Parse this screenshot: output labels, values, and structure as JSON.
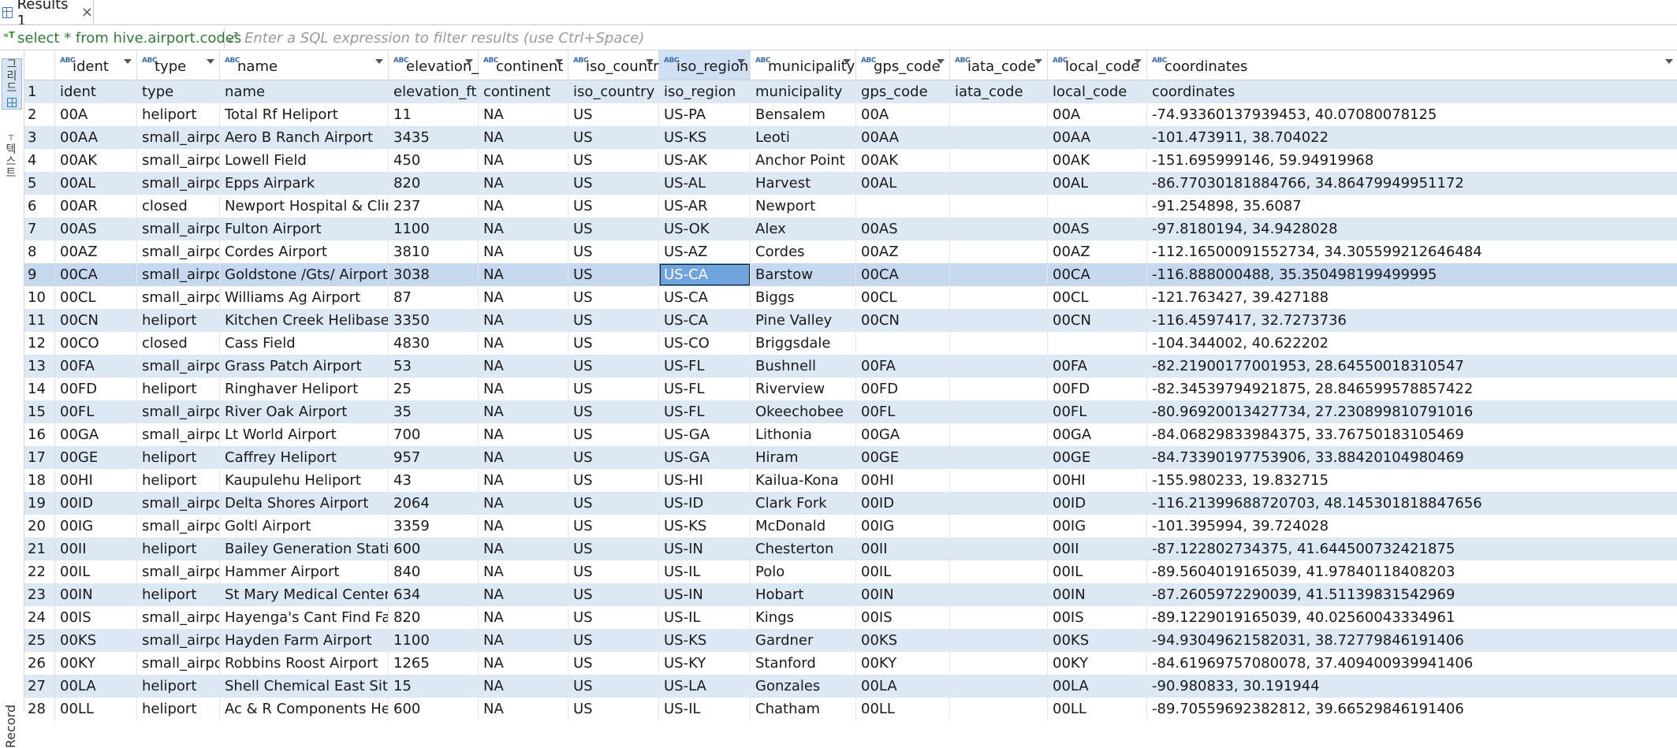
{
  "tab": {
    "title": "Results 1",
    "close": "×"
  },
  "filter": {
    "query": "select * from hive.airport.codes",
    "placeholder": "Enter a SQL expression to filter results (use Ctrl+Space)"
  },
  "sidebar": {
    "grid_label": "그리드",
    "text_label": "텍스트",
    "record_label": "Record"
  },
  "type_badge": "ABC",
  "columns": [
    "ident",
    "type",
    "name",
    "elevation_ft",
    "continent",
    "iso_country",
    "iso_region",
    "municipality",
    "gps_code",
    "iata_code",
    "local_code",
    "coordinates"
  ],
  "selected_column": "iso_region",
  "rows": [
    {
      "n": "1",
      "cells": [
        "ident",
        "type",
        "name",
        "elevation_ft",
        "continent",
        "iso_country",
        "iso_region",
        "municipality",
        "gps_code",
        "iata_code",
        "local_code",
        "coordinates"
      ]
    },
    {
      "n": "2",
      "cells": [
        "00A",
        "heliport",
        "Total Rf Heliport",
        "11",
        "NA",
        "US",
        "US-PA",
        "Bensalem",
        "00A",
        "",
        "00A",
        "-74.93360137939453, 40.07080078125"
      ]
    },
    {
      "n": "3",
      "cells": [
        "00AA",
        "small_airport",
        "Aero B Ranch Airport",
        "3435",
        "NA",
        "US",
        "US-KS",
        "Leoti",
        "00AA",
        "",
        "00AA",
        "-101.473911, 38.704022"
      ]
    },
    {
      "n": "4",
      "cells": [
        "00AK",
        "small_airport",
        "Lowell Field",
        "450",
        "NA",
        "US",
        "US-AK",
        "Anchor Point",
        "00AK",
        "",
        "00AK",
        "-151.695999146, 59.94919968"
      ]
    },
    {
      "n": "5",
      "cells": [
        "00AL",
        "small_airport",
        "Epps Airpark",
        "820",
        "NA",
        "US",
        "US-AL",
        "Harvest",
        "00AL",
        "",
        "00AL",
        "-86.77030181884766, 34.86479949951172"
      ]
    },
    {
      "n": "6",
      "cells": [
        "00AR",
        "closed",
        "Newport Hospital & Clinic Heliport",
        "237",
        "NA",
        "US",
        "US-AR",
        "Newport",
        "",
        "",
        "",
        "-91.254898, 35.6087"
      ]
    },
    {
      "n": "7",
      "cells": [
        "00AS",
        "small_airport",
        "Fulton Airport",
        "1100",
        "NA",
        "US",
        "US-OK",
        "Alex",
        "00AS",
        "",
        "00AS",
        "-97.8180194, 34.9428028"
      ]
    },
    {
      "n": "8",
      "cells": [
        "00AZ",
        "small_airport",
        "Cordes Airport",
        "3810",
        "NA",
        "US",
        "US-AZ",
        "Cordes",
        "00AZ",
        "",
        "00AZ",
        "-112.16500091552734, 34.305599212646484"
      ]
    },
    {
      "n": "9",
      "cells": [
        "00CA",
        "small_airport",
        "Goldstone /Gts/ Airport",
        "3038",
        "NA",
        "US",
        "US-CA",
        "Barstow",
        "00CA",
        "",
        "00CA",
        "-116.888000488, 35.350498199499995"
      ]
    },
    {
      "n": "10",
      "cells": [
        "00CL",
        "small_airport",
        "Williams Ag Airport",
        "87",
        "NA",
        "US",
        "US-CA",
        "Biggs",
        "00CL",
        "",
        "00CL",
        "-121.763427, 39.427188"
      ]
    },
    {
      "n": "11",
      "cells": [
        "00CN",
        "heliport",
        "Kitchen Creek Helibase Heliport",
        "3350",
        "NA",
        "US",
        "US-CA",
        "Pine Valley",
        "00CN",
        "",
        "00CN",
        "-116.4597417, 32.7273736"
      ]
    },
    {
      "n": "12",
      "cells": [
        "00CO",
        "closed",
        "Cass Field",
        "4830",
        "NA",
        "US",
        "US-CO",
        "Briggsdale",
        "",
        "",
        "",
        "-104.344002, 40.622202"
      ]
    },
    {
      "n": "13",
      "cells": [
        "00FA",
        "small_airport",
        "Grass Patch Airport",
        "53",
        "NA",
        "US",
        "US-FL",
        "Bushnell",
        "00FA",
        "",
        "00FA",
        "-82.21900177001953, 28.64550018310547"
      ]
    },
    {
      "n": "14",
      "cells": [
        "00FD",
        "heliport",
        "Ringhaver Heliport",
        "25",
        "NA",
        "US",
        "US-FL",
        "Riverview",
        "00FD",
        "",
        "00FD",
        "-82.34539794921875, 28.846599578857422"
      ]
    },
    {
      "n": "15",
      "cells": [
        "00FL",
        "small_airport",
        "River Oak Airport",
        "35",
        "NA",
        "US",
        "US-FL",
        "Okeechobee",
        "00FL",
        "",
        "00FL",
        "-80.96920013427734, 27.230899810791016"
      ]
    },
    {
      "n": "16",
      "cells": [
        "00GA",
        "small_airport",
        "Lt World Airport",
        "700",
        "NA",
        "US",
        "US-GA",
        "Lithonia",
        "00GA",
        "",
        "00GA",
        "-84.06829833984375, 33.76750183105469"
      ]
    },
    {
      "n": "17",
      "cells": [
        "00GE",
        "heliport",
        "Caffrey Heliport",
        "957",
        "NA",
        "US",
        "US-GA",
        "Hiram",
        "00GE",
        "",
        "00GE",
        "-84.73390197753906, 33.88420104980469"
      ]
    },
    {
      "n": "18",
      "cells": [
        "00HI",
        "heliport",
        "Kaupulehu Heliport",
        "43",
        "NA",
        "US",
        "US-HI",
        "Kailua-Kona",
        "00HI",
        "",
        "00HI",
        "-155.980233, 19.832715"
      ]
    },
    {
      "n": "19",
      "cells": [
        "00ID",
        "small_airport",
        "Delta Shores Airport",
        "2064",
        "NA",
        "US",
        "US-ID",
        "Clark Fork",
        "00ID",
        "",
        "00ID",
        "-116.21399688720703, 48.145301818847656"
      ]
    },
    {
      "n": "20",
      "cells": [
        "00IG",
        "small_airport",
        "Goltl Airport",
        "3359",
        "NA",
        "US",
        "US-KS",
        "McDonald",
        "00IG",
        "",
        "00IG",
        "-101.395994, 39.724028"
      ]
    },
    {
      "n": "21",
      "cells": [
        "00II",
        "heliport",
        "Bailey Generation Station Heliport",
        "600",
        "NA",
        "US",
        "US-IN",
        "Chesterton",
        "00II",
        "",
        "00II",
        "-87.122802734375, 41.644500732421875"
      ]
    },
    {
      "n": "22",
      "cells": [
        "00IL",
        "small_airport",
        "Hammer Airport",
        "840",
        "NA",
        "US",
        "US-IL",
        "Polo",
        "00IL",
        "",
        "00IL",
        "-89.5604019165039, 41.97840118408203"
      ]
    },
    {
      "n": "23",
      "cells": [
        "00IN",
        "heliport",
        "St Mary Medical Center Heliport",
        "634",
        "NA",
        "US",
        "US-IN",
        "Hobart",
        "00IN",
        "",
        "00IN",
        "-87.2605972290039, 41.51139831542969"
      ]
    },
    {
      "n": "24",
      "cells": [
        "00IS",
        "small_airport",
        "Hayenga's Cant Find Farms Airport",
        "820",
        "NA",
        "US",
        "US-IL",
        "Kings",
        "00IS",
        "",
        "00IS",
        "-89.1229019165039, 40.02560043334961"
      ]
    },
    {
      "n": "25",
      "cells": [
        "00KS",
        "small_airport",
        "Hayden Farm Airport",
        "1100",
        "NA",
        "US",
        "US-KS",
        "Gardner",
        "00KS",
        "",
        "00KS",
        "-94.93049621582031, 38.72779846191406"
      ]
    },
    {
      "n": "26",
      "cells": [
        "00KY",
        "small_airport",
        "Robbins Roost Airport",
        "1265",
        "NA",
        "US",
        "US-KY",
        "Stanford",
        "00KY",
        "",
        "00KY",
        "-84.61969757080078, 37.409400939941406"
      ]
    },
    {
      "n": "27",
      "cells": [
        "00LA",
        "heliport",
        "Shell Chemical East Site Heliport",
        "15",
        "NA",
        "US",
        "US-LA",
        "Gonzales",
        "00LA",
        "",
        "00LA",
        "-90.980833, 30.191944"
      ]
    },
    {
      "n": "28",
      "cells": [
        "00LL",
        "heliport",
        "Ac & R Components Heliport",
        "600",
        "NA",
        "US",
        "US-IL",
        "Chatham",
        "00LL",
        "",
        "00LL",
        "-89.70559692382812, 39.66529846191406"
      ]
    }
  ],
  "selected_row": "9"
}
